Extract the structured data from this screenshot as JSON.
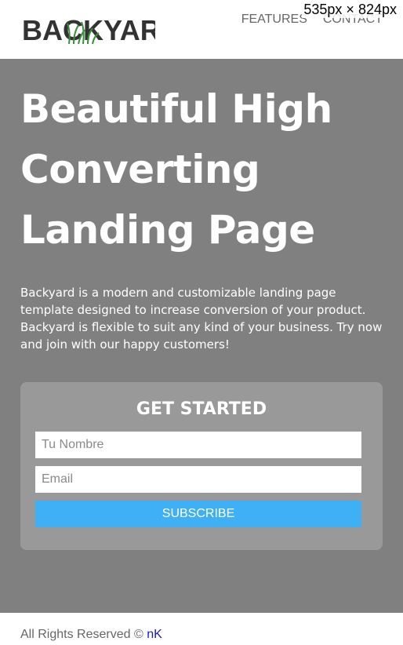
{
  "brand": {
    "logo_text": "BACKYARD",
    "logo_color": "#333333",
    "grass_color": "#3a8f3a"
  },
  "nav": {
    "items": [
      "FEATURES",
      "CONTACT"
    ]
  },
  "overlay": {
    "dimensions": "535px × 824px"
  },
  "hero": {
    "title": "Beautiful High Converting Landing Page",
    "description": "Backyard is a modern and customizable landing page template designed to increase conversion of your product. Backyard is flexible to suit any kind of your business. Try now and join with our happy customers!",
    "background_color": "#808080"
  },
  "form": {
    "heading": "GET STARTED",
    "name_placeholder": "Tu Nombre",
    "email_placeholder": "Email",
    "submit_label": "SUBSCRIBE",
    "submit_color": "#3fb0f5"
  },
  "footer": {
    "copyright": "All Rights Reserved ©",
    "author_link": "nK"
  }
}
